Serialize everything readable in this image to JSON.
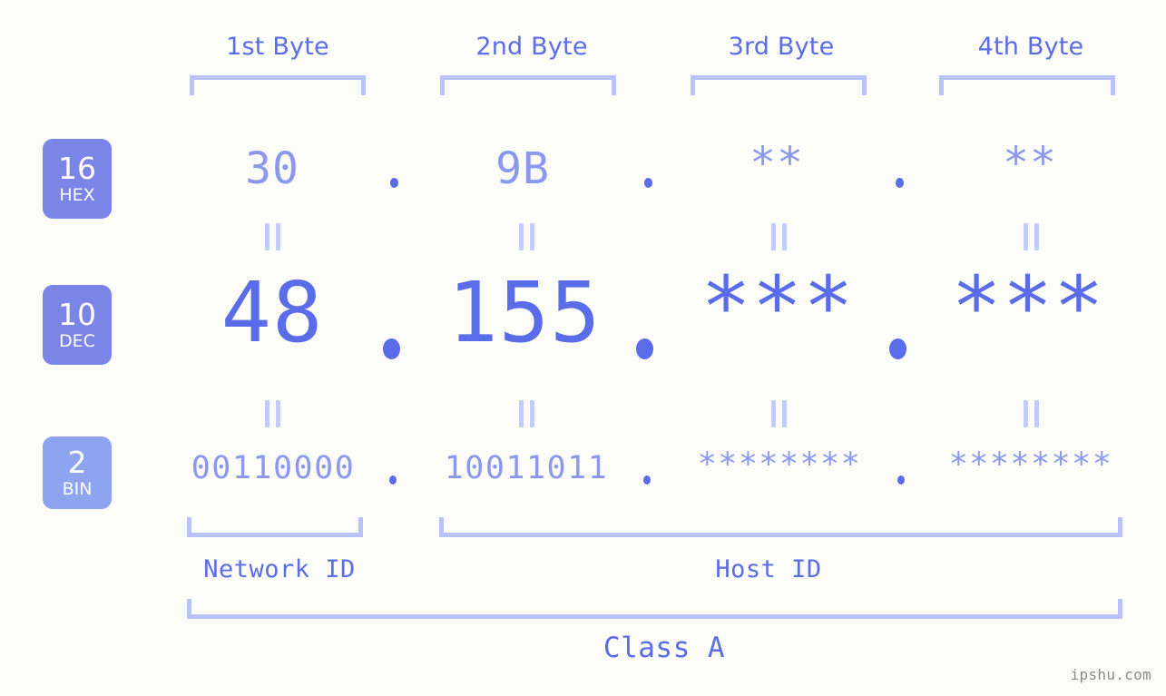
{
  "diagram": {
    "byte_headers": [
      {
        "label": "1st Byte"
      },
      {
        "label": "2nd Byte"
      },
      {
        "label": "3rd Byte"
      },
      {
        "label": "4th Byte"
      }
    ],
    "rows": [
      {
        "badge_number": "16",
        "badge_abbr": "HEX",
        "badge_color": "#7b85e8",
        "values": [
          "30",
          "9B",
          "**",
          "**"
        ],
        "separator": "."
      },
      {
        "badge_number": "10",
        "badge_abbr": "DEC",
        "badge_color": "#7b85e8",
        "values": [
          "48",
          "155",
          "***",
          "***"
        ],
        "separator": "."
      },
      {
        "badge_number": "2",
        "badge_abbr": "BIN",
        "badge_color": "#8fa4f0",
        "values": [
          "00110000",
          "10011011",
          "********",
          "********"
        ],
        "separator": "."
      }
    ],
    "equality_symbol": "=",
    "network_id_label": "Network ID",
    "host_id_label": "Host ID",
    "class_label": "Class A",
    "watermark": "ipshu.com",
    "colors": {
      "background": "#fcfdf9",
      "primary": "#5a6ce8",
      "secondary": "#8c97ee",
      "bracket": "#b8c2f7",
      "watermark": "#8a8a8a"
    }
  }
}
